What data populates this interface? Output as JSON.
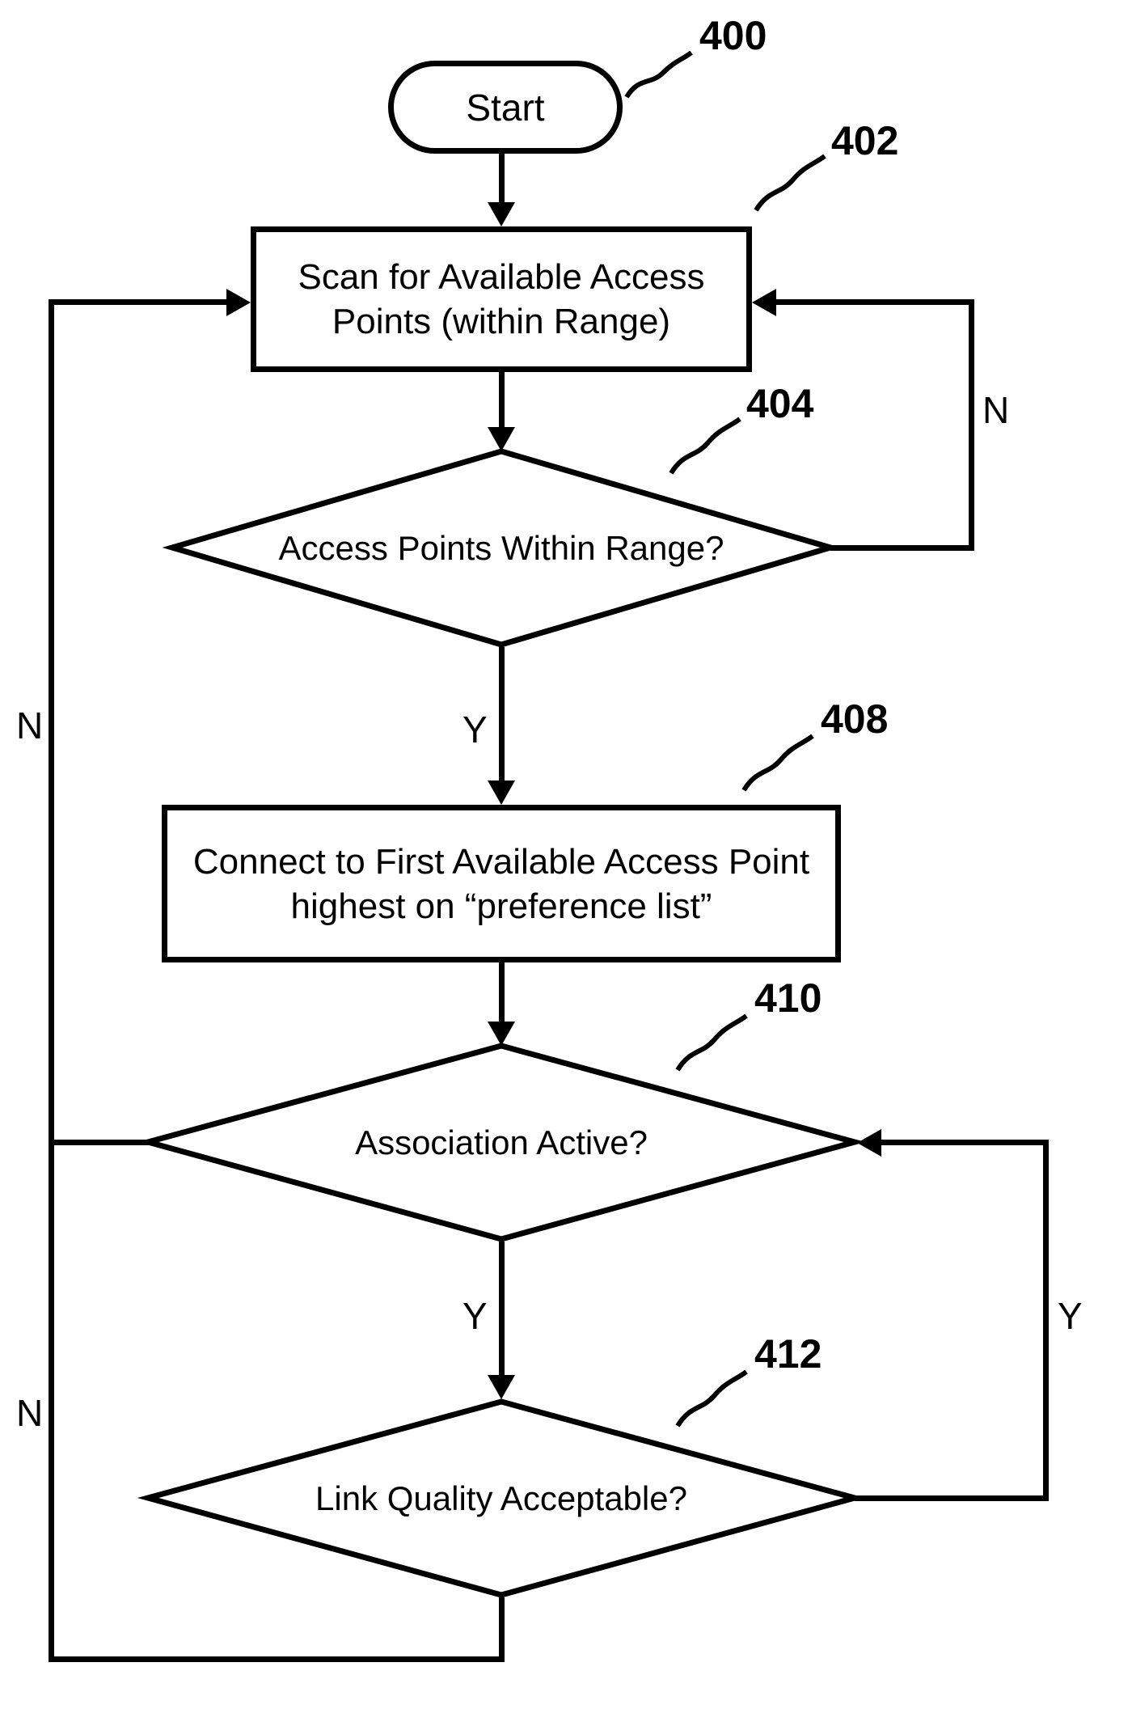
{
  "nodes": {
    "start": {
      "label": "Start",
      "ref": "400"
    },
    "scan": {
      "label": "Scan for Available Access\nPoints (within Range)",
      "ref": "402"
    },
    "ap_in_range": {
      "label": "Access Points Within Range?",
      "ref": "404"
    },
    "connect": {
      "label": "Connect to First Available Access Point\nhighest on “preference list”",
      "ref": "408"
    },
    "assoc_active": {
      "label": "Association Active?",
      "ref": "410"
    },
    "link_quality": {
      "label": "Link Quality Acceptable?",
      "ref": "412"
    }
  },
  "edges": {
    "yes": "Y",
    "no": "N"
  }
}
